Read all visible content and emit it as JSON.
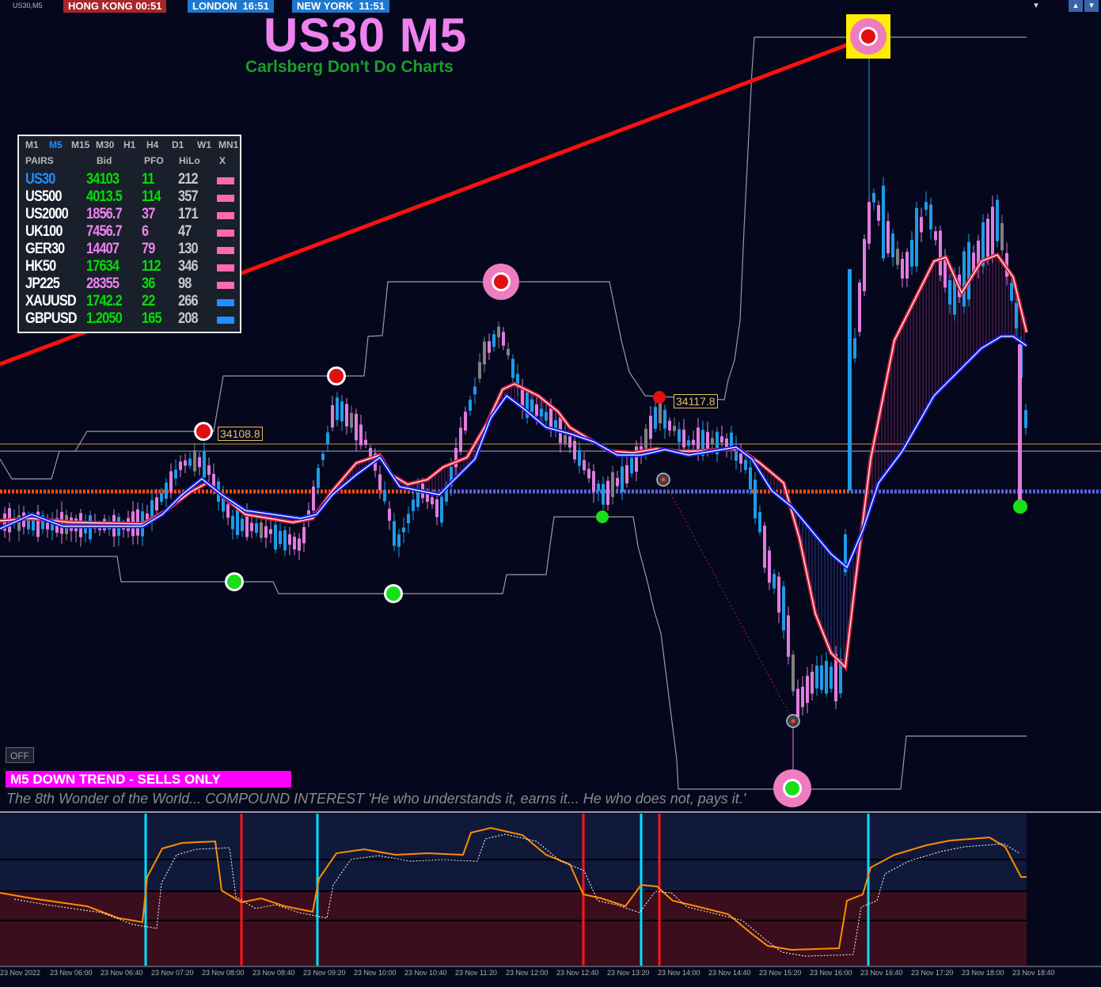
{
  "window": {
    "symbol_label": "US30,M5",
    "controls": [
      "▾",
      "▴",
      "▾"
    ]
  },
  "clocks": [
    {
      "label": "HONG KONG 00:51",
      "color": "#a8252c"
    },
    {
      "label": "LONDON  16:51",
      "color": "#1e78d0"
    },
    {
      "label": "NEW YORK  11:51",
      "color": "#1e78d0"
    }
  ],
  "title": "US30 M5",
  "subtitle": "Carlsberg Don't Do Charts",
  "panel": {
    "timeframes": [
      {
        "label": "M1",
        "active": false
      },
      {
        "label": "M5",
        "active": true
      },
      {
        "label": "M15",
        "active": false
      },
      {
        "label": "M30",
        "active": false
      },
      {
        "label": "H1",
        "active": false
      },
      {
        "label": "H4",
        "active": false
      },
      {
        "label": "D1",
        "active": false
      },
      {
        "label": "W1",
        "active": false
      },
      {
        "label": "MN1",
        "active": false
      }
    ],
    "headers": [
      "PAIRS",
      "Bid",
      "PFO",
      "HiLo",
      "X"
    ],
    "rows": [
      {
        "pair": "US30",
        "bid": "34103",
        "pfo": "11",
        "hilo": "212",
        "pair_color": "#1e90ff",
        "bid_color": "#00e000",
        "pfo_color": "#00e000",
        "x_color": "#ff69b4"
      },
      {
        "pair": "US500",
        "bid": "4013.5",
        "pfo": "114",
        "hilo": "357",
        "pair_color": "#ffffff",
        "bid_color": "#00e000",
        "pfo_color": "#00e000",
        "x_color": "#ff69b4"
      },
      {
        "pair": "US2000",
        "bid": "1856.7",
        "pfo": "37",
        "hilo": "171",
        "pair_color": "#ffffff",
        "bid_color": "#ee82ee",
        "pfo_color": "#ee82ee",
        "x_color": "#ff69b4"
      },
      {
        "pair": "UK100",
        "bid": "7456.7",
        "pfo": "6",
        "hilo": "47",
        "pair_color": "#ffffff",
        "bid_color": "#ee82ee",
        "pfo_color": "#ee82ee",
        "x_color": "#ff69b4"
      },
      {
        "pair": "GER30",
        "bid": "14407",
        "pfo": "79",
        "hilo": "130",
        "pair_color": "#ffffff",
        "bid_color": "#ee82ee",
        "pfo_color": "#ee82ee",
        "x_color": "#ff69b4"
      },
      {
        "pair": "HK50",
        "bid": "17634",
        "pfo": "112",
        "hilo": "346",
        "pair_color": "#ffffff",
        "bid_color": "#00e000",
        "pfo_color": "#00e000",
        "x_color": "#ff69b4"
      },
      {
        "pair": "JP225",
        "bid": "28355",
        "pfo": "36",
        "hilo": "98",
        "pair_color": "#ffffff",
        "bid_color": "#ee82ee",
        "pfo_color": "#00e000",
        "x_color": "#ff69b4"
      },
      {
        "pair": "XAUUSD",
        "bid": "1742.2",
        "pfo": "22",
        "hilo": "266",
        "pair_color": "#ffffff",
        "bid_color": "#00e000",
        "pfo_color": "#00e000",
        "x_color": "#1e90ff"
      },
      {
        "pair": "GBPUSD",
        "bid": "1.2050",
        "pfo": "165",
        "hilo": "208",
        "pair_color": "#ffffff",
        "bid_color": "#00e000",
        "pfo_color": "#00e000",
        "x_color": "#1e90ff"
      }
    ]
  },
  "price_labels": [
    "34108.8",
    "34117.8"
  ],
  "off_button": "OFF",
  "trend_banner": "M5  DOWN TREND - SELLS ONLY",
  "quote": "The 8th Wonder of the World... COMPOUND INTEREST 'He who understands it, earns it... He who does not, pays it.'",
  "x_axis_labels": [
    "23 Nov 2022",
    "23 Nov 06:00",
    "23 Nov 06:40",
    "23 Nov 07:20",
    "23 Nov 08:00",
    "23 Nov 08:40",
    "23 Nov 09:20",
    "23 Nov 10:00",
    "23 Nov 10:40",
    "23 Nov 11:20",
    "23 Nov 12:00",
    "23 Nov 12:40",
    "23 Nov 13:20",
    "23 Nov 14:00",
    "23 Nov 14:40",
    "23 Nov 15:20",
    "23 Nov 16:00",
    "23 Nov 16:40",
    "23 Nov 17:20",
    "23 Nov 18:00",
    "23 Nov 18:40"
  ],
  "colors": {
    "background": "#05081c",
    "bull_candle": "#1e9be8",
    "bear_candle": "#e07ce0",
    "neutral_candle": "#808080",
    "red_ma": "#d0203c",
    "blue_ma": "#1420e0",
    "trendline": "#ff1010",
    "pivot_orange": "#ff4a10",
    "pivot_blue": "#5a64e0",
    "oscillator_orange": "#ff8c00",
    "buy_signal": "#00e0ff",
    "sell_signal": "#ff1818"
  }
}
